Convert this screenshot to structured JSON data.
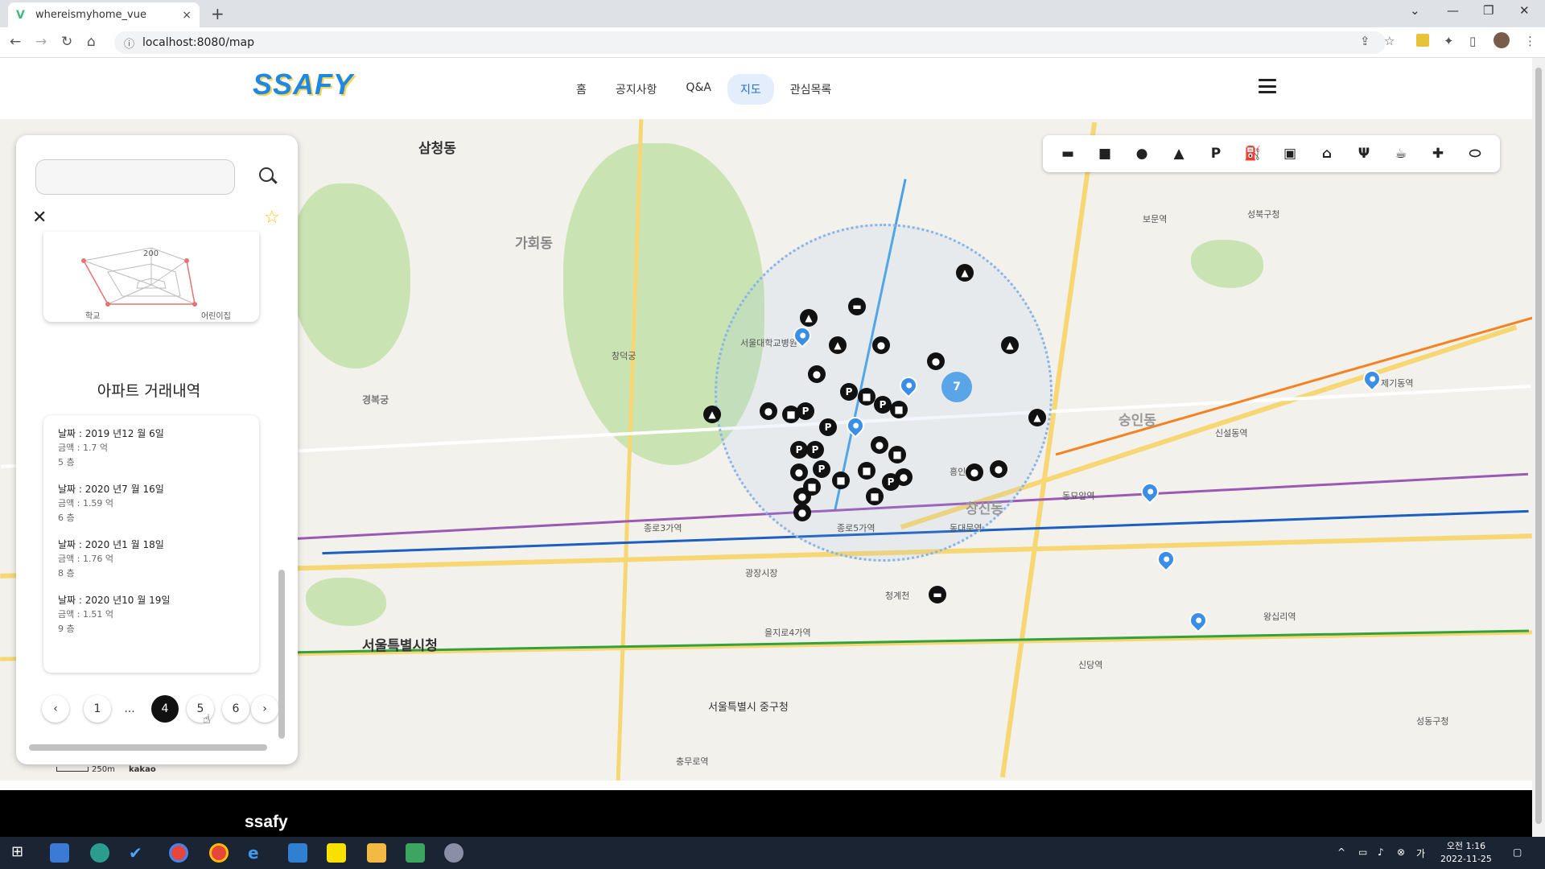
{
  "browser": {
    "tab_title": "whereismyhome_vue",
    "tab_close": "×",
    "new_tab": "+",
    "url": "localhost:8080/map",
    "info": "ⓘ"
  },
  "header": {
    "logo_text": "SSAFY",
    "nav": [
      "홈",
      "공지사항",
      "Q&A",
      "지도",
      "관심목록"
    ],
    "active_nav": "지도"
  },
  "map": {
    "labels": [
      "삼청동",
      "서울특별시청",
      "가회동",
      "서울특별시 중구청",
      "서울대학교병원",
      "흥인지문",
      "종로5가역",
      "을지로4가역",
      "동대문역",
      "신설동역",
      "보문역",
      "성북구청",
      "창덕궁",
      "경복궁",
      "종로3가역",
      "청계천",
      "광장시장",
      "신당역",
      "제기동역",
      "왕십리역",
      "성동구청",
      "충무로역",
      "동묘앞역",
      "창신동",
      "숭인동"
    ],
    "cluster_count": "7",
    "scale_text": "250m",
    "kakao": "kakao"
  },
  "categories": [
    "store",
    "car",
    "kindergarten",
    "school",
    "parking",
    "gas-station",
    "subway",
    "bank",
    "restaurant",
    "cafe",
    "hospital",
    "pharmacy"
  ],
  "side_panel": {
    "search_placeholder": "",
    "radar": {
      "top_value": "200",
      "left_label": "학교",
      "right_label": "어린이집"
    },
    "section_title": "아파트 거래내역",
    "deals": [
      {
        "date": "날짜 : 2019 년12 월 6일",
        "amount": "금액 : 1.7 억",
        "floor": "5 층"
      },
      {
        "date": "날짜 : 2020 년7 월 16일",
        "amount": "금액 : 1.59 억",
        "floor": "6 층"
      },
      {
        "date": "날짜 : 2020 년1 월 18일",
        "amount": "금액 : 1.76 억",
        "floor": "8 층"
      },
      {
        "date": "날짜 : 2020 년10 월 19일",
        "amount": "금액 : 1.51 억",
        "floor": "9 층"
      }
    ],
    "pagination": {
      "prev": "‹",
      "first": "1",
      "ellipsis": "...",
      "current": "4",
      "next_a": "5",
      "next_b": "6",
      "next": "›"
    }
  },
  "footer": {
    "brand": "ssafy"
  },
  "taskbar": {
    "time": "오전 1:16",
    "date": "2022-11-25"
  }
}
